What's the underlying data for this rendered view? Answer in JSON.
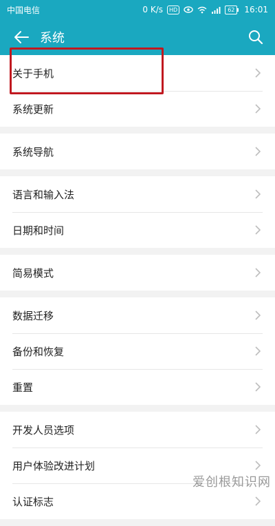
{
  "statusbar": {
    "carrier": "中国电信",
    "speed": "0 K/s",
    "hd": "HD",
    "battery": "62",
    "time": "16:01"
  },
  "appbar": {
    "title": "系统",
    "back_icon": "arrow-left-icon",
    "search_icon": "search-icon"
  },
  "groups": [
    {
      "items": [
        {
          "label": "关于手机"
        },
        {
          "label": "系统更新"
        }
      ]
    },
    {
      "items": [
        {
          "label": "系统导航"
        }
      ]
    },
    {
      "items": [
        {
          "label": "语言和输入法"
        },
        {
          "label": "日期和时间"
        }
      ]
    },
    {
      "items": [
        {
          "label": "简易模式"
        }
      ]
    },
    {
      "items": [
        {
          "label": "数据迁移"
        },
        {
          "label": "备份和恢复"
        },
        {
          "label": "重置"
        }
      ]
    },
    {
      "items": [
        {
          "label": "开发人员选项"
        },
        {
          "label": "用户体验改进计划"
        },
        {
          "label": "认证标志"
        }
      ]
    }
  ],
  "colors": {
    "accent": "#1aa8c0",
    "highlight": "#c0181f"
  },
  "watermark": "爱创根知识网"
}
